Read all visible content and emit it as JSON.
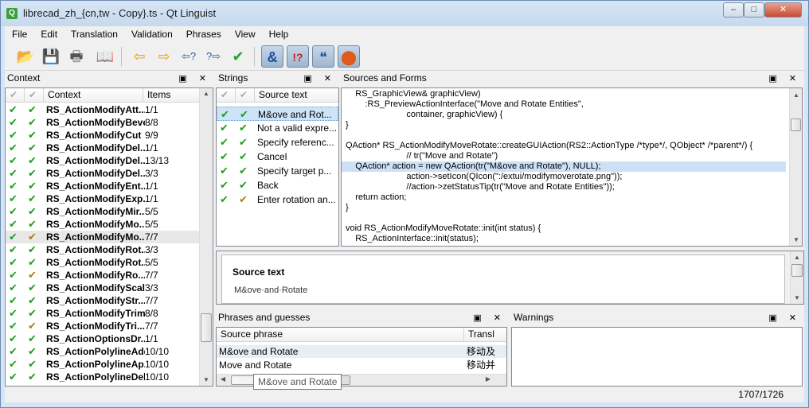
{
  "window": {
    "title": "librecad_zh_{cn,tw - Copy}.ts - Qt Linguist",
    "app_icon": "Q",
    "min": "–",
    "max": "□",
    "close": "✕"
  },
  "menu": [
    "File",
    "Edit",
    "Translation",
    "Validation",
    "Phrases",
    "View",
    "Help"
  ],
  "toolbar": [
    {
      "name": "open-icon",
      "glyph": "📂"
    },
    {
      "name": "save-icon",
      "glyph": "💾"
    },
    {
      "name": "print-icon",
      "glyph": "🖶"
    },
    {
      "name": "phrasebook-icon",
      "glyph": "📖"
    },
    {
      "name": "prev-icon",
      "glyph": "⇦"
    },
    {
      "name": "next-icon",
      "glyph": "⇨"
    },
    {
      "name": "prev-unfinished-icon",
      "glyph": "⇦?"
    },
    {
      "name": "next-unfinished-icon",
      "glyph": "?⇨"
    },
    {
      "name": "done-next-icon",
      "glyph": "✔"
    },
    {
      "name": "accelerator-check-icon",
      "glyph": "&"
    },
    {
      "name": "punctuation-check-icon",
      "glyph": "!?"
    },
    {
      "name": "phrase-match-check-icon",
      "glyph": "❝"
    },
    {
      "name": "place-marker-check-icon",
      "glyph": "⬤"
    }
  ],
  "context_panel": {
    "title": "Context",
    "col_context": "Context",
    "col_items": "Items",
    "rows": [
      {
        "name": "RS_ActionModifyAtt...",
        "items": "1/1",
        "c1": "g",
        "c2": "g"
      },
      {
        "name": "RS_ActionModifyBeve",
        "items": "8/8",
        "c1": "g",
        "c2": "g"
      },
      {
        "name": "RS_ActionModifyCut",
        "items": "9/9",
        "c1": "g",
        "c2": "g"
      },
      {
        "name": "RS_ActionModifyDel...",
        "items": "1/1",
        "c1": "g",
        "c2": "g"
      },
      {
        "name": "RS_ActionModifyDel...",
        "items": "13/13",
        "c1": "g",
        "c2": "g"
      },
      {
        "name": "RS_ActionModifyDel...",
        "items": "3/3",
        "c1": "g",
        "c2": "g"
      },
      {
        "name": "RS_ActionModifyEnt...",
        "items": "1/1",
        "c1": "g",
        "c2": "g"
      },
      {
        "name": "RS_ActionModifyExp...",
        "items": "1/1",
        "c1": "g",
        "c2": "g"
      },
      {
        "name": "RS_ActionModifyMir...",
        "items": "5/5",
        "c1": "g",
        "c2": "g"
      },
      {
        "name": "RS_ActionModifyMo...",
        "items": "5/5",
        "c1": "g",
        "c2": "g"
      },
      {
        "name": "RS_ActionModifyMo...",
        "items": "7/7",
        "c1": "g",
        "c2": "o",
        "sel": true
      },
      {
        "name": "RS_ActionModifyRot...",
        "items": "3/3",
        "c1": "g",
        "c2": "g"
      },
      {
        "name": "RS_ActionModifyRot...",
        "items": "5/5",
        "c1": "g",
        "c2": "g"
      },
      {
        "name": "RS_ActionModifyRo...",
        "items": "7/7",
        "c1": "g",
        "c2": "o"
      },
      {
        "name": "RS_ActionModifyScale",
        "items": "3/3",
        "c1": "g",
        "c2": "g"
      },
      {
        "name": "RS_ActionModifyStr...",
        "items": "7/7",
        "c1": "g",
        "c2": "g"
      },
      {
        "name": "RS_ActionModifyTrim",
        "items": "8/8",
        "c1": "g",
        "c2": "g"
      },
      {
        "name": "RS_ActionModifyTri...",
        "items": "7/7",
        "c1": "g",
        "c2": "o"
      },
      {
        "name": "RS_ActionOptionsDr...",
        "items": "1/1",
        "c1": "g",
        "c2": "g"
      },
      {
        "name": "RS_ActionPolylineAdd",
        "items": "10/10",
        "c1": "g",
        "c2": "g"
      },
      {
        "name": "RS_ActionPolylineAp...",
        "items": "10/10",
        "c1": "g",
        "c2": "g"
      },
      {
        "name": "RS_ActionPolylineDel",
        "items": "10/10",
        "c1": "g",
        "c2": "g"
      }
    ]
  },
  "strings_panel": {
    "title": "Strings",
    "col_source": "Source text",
    "rows": [
      {
        "text": "M&ove and Rot...",
        "c1": "g",
        "c2": "g",
        "sel": true
      },
      {
        "text": "Not a valid expre...",
        "c1": "g",
        "c2": "g"
      },
      {
        "text": "Specify referenc...",
        "c1": "g",
        "c2": "g"
      },
      {
        "text": "Cancel",
        "c1": "g",
        "c2": "g"
      },
      {
        "text": "Specify target p...",
        "c1": "g",
        "c2": "g"
      },
      {
        "text": "Back",
        "c1": "g",
        "c2": "g"
      },
      {
        "text": "Enter rotation an...",
        "c1": "g",
        "c2": "o"
      }
    ]
  },
  "sources_panel": {
    "title": "Sources and Forms",
    "lines": [
      "    RS_GraphicView& graphicView)",
      "        :RS_PreviewActionInterface(\"Move and Rotate Entities\",",
      "                         container, graphicView) {",
      "}",
      "",
      "QAction* RS_ActionModifyMoveRotate::createGUIAction(RS2::ActionType /*type*/, QObject* /*parent*/) {",
      "                         // tr(\"Move and Rotate\")",
      "    QAction* action = new QAction(tr(\"M&ove and Rotate\"), NULL);",
      "                         action->setIcon(QIcon(\":/extui/modifymoverotate.png\"));",
      "                         //action->zetStatusTip(tr(\"Move and Rotate Entities\"));",
      "    return action;",
      "}",
      "",
      "void RS_ActionModifyMoveRotate::init(int status) {",
      "    RS_ActionInterface::init(status);"
    ],
    "highlight_index": 7
  },
  "editor": {
    "heading": "Source text",
    "source": "M&ove·and·Rotate"
  },
  "phrases_panel": {
    "title": "Phrases and guesses",
    "col_phrase": "Source phrase",
    "col_trans": "Transl",
    "rows": [
      {
        "phrase": "M&ove and Rotate",
        "trans": "移动及"
      },
      {
        "phrase": "Move and Rotate",
        "trans": "移动并"
      }
    ]
  },
  "warnings_panel": {
    "title": "Warnings"
  },
  "status": {
    "counter": "1707/1726"
  },
  "tooltip": {
    "text": "M&ove and Rotate"
  },
  "dock_buttons": "▣ ✕"
}
